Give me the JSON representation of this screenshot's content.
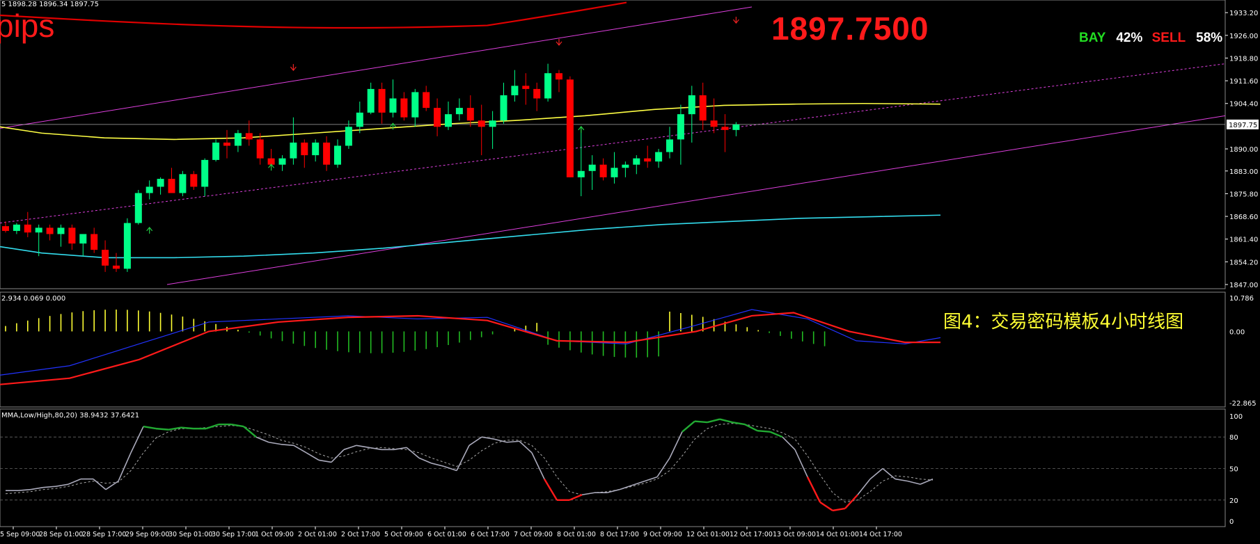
{
  "colors": {
    "bull": "#00ff88",
    "bear": "#ff0000",
    "background": "#000000"
  },
  "header": {
    "ohlc": "5 1898.28 1896.34 1897.75",
    "macd": "2.934 0.069 0.000",
    "stoch": "MMA,Low/High,80,20) 38.9432 37.6421"
  },
  "overlay": {
    "big_price": "1897.7500",
    "pips": "pips",
    "bay_label": "BAY",
    "bay_pct": "42%",
    "sell_label": "SELL",
    "sell_pct": "58%",
    "caption": "图4：交易密码模板4小时线图"
  },
  "chart_data": [
    {
      "type": "candlestick",
      "current_price": "1897.75",
      "y_ticks": [
        "1933.20",
        "1926.00",
        "1918.80",
        "1911.60",
        "1904.40",
        "1897.75",
        "1890.00",
        "1883.00",
        "1875.80",
        "1868.60",
        "1861.40",
        "1854.20",
        "1847.00"
      ],
      "ylim": [
        1847.0,
        1935.0
      ],
      "x_ticks": [
        "25 Sep 09:00",
        "28 Sep 01:00",
        "28 Sep 17:00",
        "29 Sep 09:00",
        "30 Sep 01:00",
        "30 Sep 17:00",
        "1 Oct 09:00",
        "2 Oct 01:00",
        "2 Oct 17:00",
        "5 Oct 09:00",
        "6 Oct 01:00",
        "6 Oct 17:00",
        "7 Oct 09:00",
        "8 Oct 01:00",
        "8 Oct 17:00",
        "9 Oct 09:00",
        "12 Oct 01:00",
        "12 Oct 17:00",
        "13 Oct 09:00",
        "14 Oct 01:00",
        "14 Oct 17:00"
      ],
      "x_tick_positions": [
        1,
        4,
        7,
        10,
        13,
        16,
        19,
        22,
        25,
        28,
        31,
        34,
        37,
        40,
        43,
        46,
        49,
        52,
        55,
        58,
        61
      ],
      "candles": [
        [
          1865.5,
          1867.0,
          1863.5,
          1864.0
        ],
        [
          1864.0,
          1866.5,
          1863.0,
          1866.0
        ],
        [
          1866.0,
          1870.0,
          1862.0,
          1863.5
        ],
        [
          1863.5,
          1866.0,
          1856.0,
          1865.0
        ],
        [
          1865.0,
          1866.0,
          1861.0,
          1863.0
        ],
        [
          1863.0,
          1866.0,
          1859.0,
          1865.0
        ],
        [
          1865.0,
          1866.0,
          1858.0,
          1860.0
        ],
        [
          1860.0,
          1863.0,
          1856.0,
          1863.0
        ],
        [
          1863.0,
          1865.0,
          1857.0,
          1858.0
        ],
        [
          1858.0,
          1861.0,
          1851.0,
          1853.0
        ],
        [
          1853.0,
          1857.0,
          1851.0,
          1852.0
        ],
        [
          1852.0,
          1868.0,
          1851.0,
          1866.5
        ],
        [
          1866.5,
          1877.0,
          1866.0,
          1876.0
        ],
        [
          1876.0,
          1880.0,
          1874.0,
          1878.0
        ],
        [
          1878.0,
          1881.0,
          1875.5,
          1880.5
        ],
        [
          1880.5,
          1884.0,
          1879.0,
          1876.0
        ],
        [
          1876.0,
          1883.0,
          1875.0,
          1882.0
        ],
        [
          1882.0,
          1883.0,
          1877.0,
          1878.0
        ],
        [
          1878.0,
          1887.0,
          1875.0,
          1886.5
        ],
        [
          1886.5,
          1893.0,
          1886.0,
          1892.0
        ],
        [
          1892.0,
          1896.0,
          1887.0,
          1891.0
        ],
        [
          1891.0,
          1896.0,
          1889.0,
          1895.0
        ],
        [
          1895.0,
          1899.0,
          1891.0,
          1893.0
        ],
        [
          1893.0,
          1895.0,
          1885.0,
          1887.0
        ],
        [
          1887.0,
          1890.0,
          1884.5,
          1885.0
        ],
        [
          1885.0,
          1888.0,
          1883.0,
          1887.0
        ],
        [
          1887.0,
          1900.0,
          1885.0,
          1892.0
        ],
        [
          1892.0,
          1893.0,
          1884.0,
          1888.0
        ],
        [
          1888.0,
          1893.0,
          1886.0,
          1892.0
        ],
        [
          1892.0,
          1894.0,
          1883.0,
          1885.0
        ],
        [
          1885.0,
          1893.0,
          1884.0,
          1891.0
        ],
        [
          1891.0,
          1899.0,
          1890.0,
          1897.0
        ],
        [
          1897.0,
          1905.0,
          1895.0,
          1901.5
        ],
        [
          1901.5,
          1911.0,
          1901.0,
          1909.0
        ],
        [
          1909.0,
          1911.0,
          1898.0,
          1901.5
        ],
        [
          1901.5,
          1912.0,
          1900.0,
          1906.0
        ],
        [
          1906.0,
          1908.0,
          1899.0,
          1900.0
        ],
        [
          1900.0,
          1909.0,
          1897.0,
          1908.0
        ],
        [
          1908.0,
          1910.0,
          1902.0,
          1903.0
        ],
        [
          1903.0,
          1906.0,
          1894.0,
          1897.0
        ],
        [
          1897.0,
          1905.0,
          1896.0,
          1901.0
        ],
        [
          1901.0,
          1906.0,
          1899.0,
          1903.0
        ],
        [
          1903.0,
          1907.0,
          1897.0,
          1899.0
        ],
        [
          1899.0,
          1904.0,
          1888.0,
          1897.0
        ],
        [
          1897.0,
          1902.0,
          1890.0,
          1899.0
        ],
        [
          1899.0,
          1911.0,
          1898.0,
          1907.0
        ],
        [
          1907.0,
          1915.0,
          1905.0,
          1910.0
        ],
        [
          1910.0,
          1914.0,
          1904.0,
          1909.0
        ],
        [
          1909.0,
          1911.0,
          1902.0,
          1906.0
        ],
        [
          1906.0,
          1917.0,
          1905.0,
          1914.0
        ],
        [
          1914.0,
          1915.0,
          1908.0,
          1912.0
        ],
        [
          1912.0,
          1913.0,
          1881.0,
          1881.0
        ],
        [
          1881.0,
          1897.0,
          1875.0,
          1883.0
        ],
        [
          1883.0,
          1888.0,
          1877.0,
          1885.0
        ],
        [
          1885.0,
          1887.0,
          1880.0,
          1881.0
        ],
        [
          1881.0,
          1889.0,
          1879.0,
          1884.0
        ],
        [
          1884.0,
          1886.0,
          1881.0,
          1885.0
        ],
        [
          1885.0,
          1888.0,
          1882.0,
          1887.0
        ],
        [
          1887.0,
          1891.0,
          1884.0,
          1886.0
        ],
        [
          1886.0,
          1890.0,
          1884.0,
          1889.0
        ],
        [
          1889.0,
          1897.0,
          1887.0,
          1893.0
        ],
        [
          1893.0,
          1904.0,
          1885.0,
          1901.0
        ],
        [
          1901.0,
          1910.0,
          1892.0,
          1907.0
        ],
        [
          1907.0,
          1911.0,
          1896.0,
          1899.0
        ],
        [
          1899.0,
          1906.0,
          1895.0,
          1897.0
        ],
        [
          1897.0,
          1901.0,
          1889.0,
          1896.0
        ],
        [
          1896.0,
          1898.5,
          1894.0,
          1897.75
        ]
      ]
    },
    {
      "type": "macd",
      "y_ticks": [
        "10.786",
        "0.00",
        "-22.865"
      ],
      "ylim": [
        -22.865,
        10.786
      ]
    },
    {
      "type": "stochastic",
      "y_ticks": [
        "100",
        "80",
        "50",
        "20",
        "0"
      ],
      "ylim": [
        0,
        100
      ],
      "k": [
        29,
        29,
        30,
        32,
        33,
        35,
        40,
        40,
        30,
        38,
        65,
        90,
        88,
        87,
        89,
        88,
        88,
        92,
        92,
        90,
        80,
        75,
        73,
        72,
        65,
        58,
        56,
        68,
        72,
        70,
        68,
        68,
        70,
        60,
        55,
        52,
        48,
        72,
        80,
        78,
        75,
        76,
        65,
        40,
        20,
        20,
        25,
        27,
        27,
        30,
        34,
        38,
        42,
        60,
        85,
        95,
        94,
        97,
        94,
        92,
        86,
        85,
        80,
        68,
        42,
        18,
        10,
        12,
        25,
        40,
        50,
        40,
        38,
        35,
        40
      ],
      "d": [
        26,
        27,
        28,
        30,
        31,
        33,
        36,
        38,
        36,
        37,
        48,
        65,
        79,
        85,
        88,
        88,
        89,
        90,
        91,
        90,
        86,
        82,
        77,
        74,
        70,
        64,
        60,
        62,
        66,
        69,
        70,
        69,
        68,
        65,
        60,
        56,
        52,
        58,
        67,
        74,
        77,
        77,
        72,
        60,
        42,
        28,
        25,
        27,
        28,
        30,
        33,
        36,
        40,
        48,
        62,
        78,
        88,
        92,
        93,
        92,
        90,
        88,
        84,
        78,
        62,
        44,
        27,
        18,
        20,
        28,
        38,
        43,
        42,
        40,
        39
      ]
    }
  ]
}
